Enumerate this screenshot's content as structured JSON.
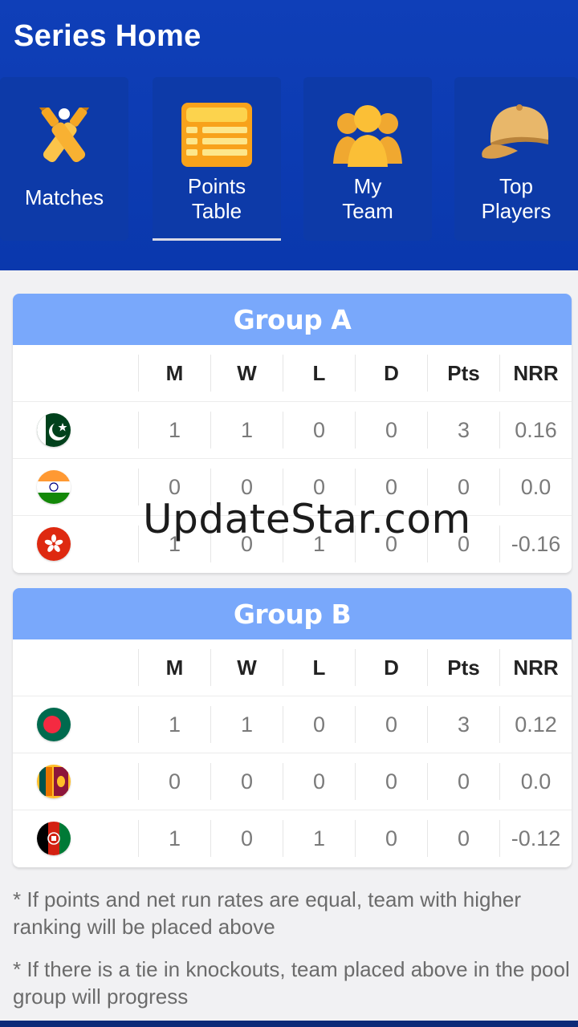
{
  "header": {
    "title": "Series Home",
    "tabs": [
      {
        "label": "Matches",
        "icon": "cricket-bats-icon"
      },
      {
        "label": "Points\nTable",
        "icon": "points-table-icon",
        "selected": true
      },
      {
        "label": "My\nTeam",
        "icon": "team-icon"
      },
      {
        "label": "Top\nPlayers",
        "icon": "cap-icon"
      }
    ]
  },
  "table_columns": [
    "M",
    "W",
    "L",
    "D",
    "Pts",
    "NRR"
  ],
  "groups": [
    {
      "title": "Group A",
      "rows": [
        {
          "flag": "pakistan-flag-icon",
          "values": [
            "1",
            "1",
            "0",
            "0",
            "3",
            "0.16"
          ]
        },
        {
          "flag": "india-flag-icon",
          "values": [
            "0",
            "0",
            "0",
            "0",
            "0",
            "0.0"
          ]
        },
        {
          "flag": "hong-kong-flag-icon",
          "values": [
            "1",
            "0",
            "1",
            "0",
            "0",
            "-0.16"
          ]
        }
      ]
    },
    {
      "title": "Group B",
      "rows": [
        {
          "flag": "bangladesh-flag-icon",
          "values": [
            "1",
            "1",
            "0",
            "0",
            "3",
            "0.12"
          ]
        },
        {
          "flag": "sri-lanka-flag-icon",
          "values": [
            "0",
            "0",
            "0",
            "0",
            "0",
            "0.0"
          ]
        },
        {
          "flag": "afghanistan-flag-icon",
          "values": [
            "1",
            "0",
            "1",
            "0",
            "0",
            "-0.12"
          ]
        }
      ]
    }
  ],
  "notes": [
    "* If points and net run rates are equal, team with higher ranking will be placed above",
    "* If there is a tie in knockouts, team placed above in the pool group will progress"
  ],
  "watermark": "UpdateStar.com",
  "colors": {
    "header_bg": "#0f3fb8",
    "group_header_bg": "#79a8fb",
    "icon_orange": "#f8a21b",
    "icon_yellow": "#fbc44a"
  }
}
